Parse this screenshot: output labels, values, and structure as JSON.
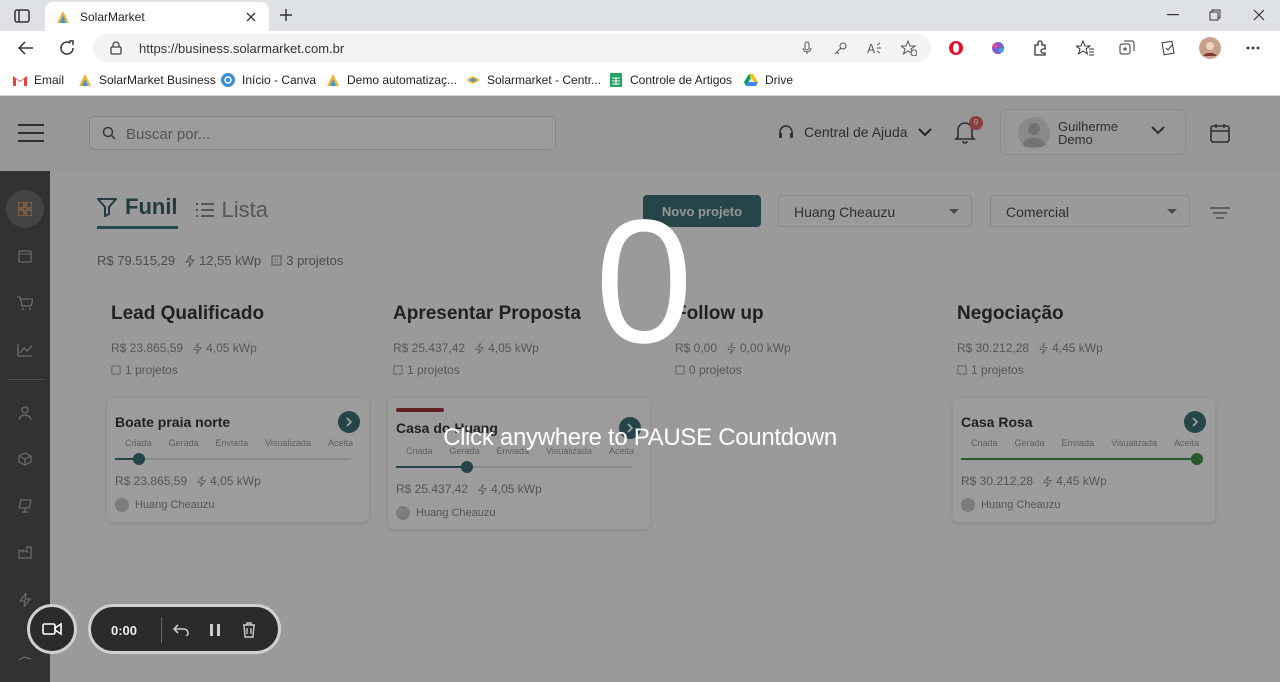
{
  "browser": {
    "tab_title": "SolarMarket",
    "url": "https://business.solarmarket.com.br",
    "bookmarks": [
      {
        "label": "Email",
        "icon": "gmail-icon"
      },
      {
        "label": "SolarMarket Business",
        "icon": "solarmarket-icon"
      },
      {
        "label": "Início - Canva",
        "icon": "canva-icon"
      },
      {
        "label": "Demo automatizaç...",
        "icon": "solarmarket-icon"
      },
      {
        "label": "Solarmarket - Centr...",
        "icon": "solarmarket-icon"
      },
      {
        "label": "Controle de Artigos",
        "icon": "sheets-icon"
      },
      {
        "label": "Drive",
        "icon": "drive-icon"
      }
    ]
  },
  "header": {
    "search_placeholder": "Buscar por...",
    "help_label": "Central de Ajuda",
    "notification_count": "9",
    "user_name": "Guilherme Demo"
  },
  "views": {
    "funnel_label": "Funil",
    "list_label": "Lista"
  },
  "controls": {
    "new_project_label": "Novo projeto",
    "owner_select": "Huang Cheauzu",
    "pipeline_select": "Comercial"
  },
  "summary": {
    "total_value": "R$ 79.515,29",
    "total_power": "12,55 kWp",
    "total_projects": "3 projetos"
  },
  "columns": [
    {
      "title": "Lead Qualificado",
      "value": "R$ 23.865,59",
      "power": "4,05 kWp",
      "projects": "1 projetos"
    },
    {
      "title": "Apresentar Proposta",
      "value": "R$ 25.437,42",
      "power": "4,05 kWp",
      "projects": "1 projetos"
    },
    {
      "title": "Follow up",
      "value": "R$ 0,00",
      "power": "0,00 kWp",
      "projects": "0 projetos"
    },
    {
      "title": "Negociação",
      "value": "R$ 30.212,28",
      "power": "4,45 kWp",
      "projects": "1 projetos"
    }
  ],
  "step_labels": [
    "Criada",
    "Gerada",
    "Enviada",
    "Visualizada",
    "Aceita"
  ],
  "cards": [
    {
      "title": "Boate praia norte",
      "value": "R$ 23.865,59",
      "power": "4,05 kWp",
      "owner": "Huang Cheauzu",
      "progress": 0.1
    },
    {
      "title": "Casa do Huang",
      "value": "R$ 25.437,42",
      "power": "4,05 kWp",
      "owner": "Huang Cheauzu",
      "progress": 0.3
    },
    {
      "title": "Casa Rosa",
      "value": "R$ 30.212,28",
      "power": "4,45 kWp",
      "owner": "Huang Cheauzu",
      "progress": 1.0
    }
  ],
  "overlay": {
    "countdown": "0",
    "message": "Click anywhere to PAUSE Countdown"
  },
  "recorder": {
    "time": "0:00"
  },
  "colors": {
    "brand": "#235a61",
    "accent_red": "#8b1a1a",
    "success": "#2e7d32"
  }
}
